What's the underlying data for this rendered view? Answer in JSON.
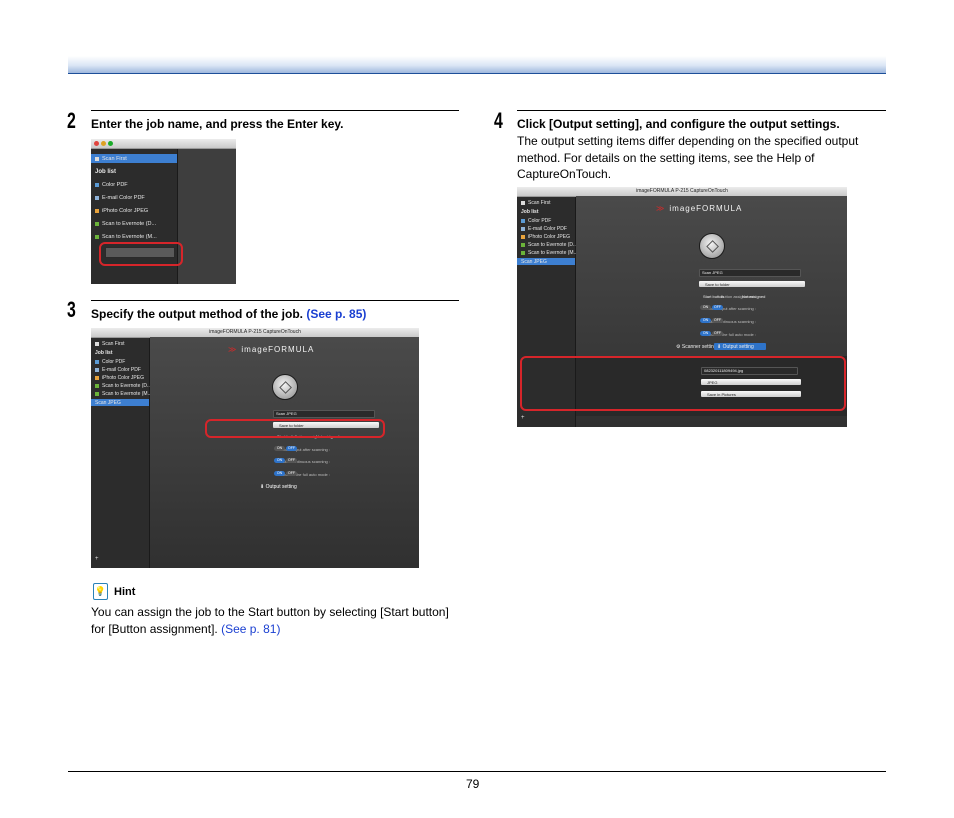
{
  "page": {
    "number": "79"
  },
  "step2": {
    "num": "2",
    "title": "Enter the job name, and press the Enter key.",
    "screenshot": {
      "sidebar": {
        "selected": "Scan First",
        "header": "Job list",
        "items": [
          "Color PDF",
          "E-mail Color PDF",
          "iPhoto Color JPEG",
          "Scan to Evernote (D...",
          "Scan to Evernote (M..."
        ]
      }
    }
  },
  "step3": {
    "num": "3",
    "title": "Specify the output method of the job.",
    "link": "(See p. 85)",
    "screenshot": {
      "window_title": "imageFORMULA P-215 CaptureOnTouch",
      "sidebar": {
        "selected": "Scan First",
        "header": "Job list",
        "items": [
          "Color PDF",
          "E-mail Color PDF",
          "iPhoto Color JPEG",
          "Scan to Evernote (D...",
          "Scan to Evernote (M..."
        ],
        "new_item": "Scan JPEG"
      },
      "logo": "imageFORMULA",
      "fields": {
        "job_title_label": "Job title :",
        "job_title_value": "Scan JPEG",
        "output_method_label": "Output method selection :",
        "output_method_value": "Save to folder",
        "button_assignment_label": "Button assignment :",
        "start_button": "Start button",
        "not_assigned": "Not assigned",
        "check_output_label": "Check output after scanning :",
        "continuous_label": "Enable continuous scanning :",
        "full_auto_label": "Scan in the full auto mode :",
        "on": "ON",
        "off": "OFF"
      },
      "output_setting": "Output setting"
    }
  },
  "hint": {
    "title": "Hint",
    "text": "You can assign the job to the Start button by selecting [Start button] for [Button assignment].",
    "link": "(See p. 81)"
  },
  "step4": {
    "num": "4",
    "title": "Click [Output setting], and configure the output settings.",
    "body": "The output setting items differ depending on the specified output method. For details on the setting items, see the Help of CaptureOnTouch.",
    "screenshot": {
      "window_title": "imageFORMULA P-215 CaptureOnTouch",
      "sidebar": {
        "selected": "Scan First",
        "header": "Job list",
        "items": [
          "Color PDF",
          "E-mail Color PDF",
          "iPhoto Color JPEG",
          "Scan to Evernote (D...",
          "Scan to Evernote (M..."
        ],
        "new_item": "Scan JPEG"
      },
      "logo": "imageFORMULA",
      "fields": {
        "job_title_label": "Job title :",
        "job_title_value": "Scan JPEG",
        "output_method_label": "Output method selection :",
        "output_method_value": "Save to folder",
        "button_assignment_label": "Button assignment :",
        "start_button": "Start button",
        "not_assigned": "Not assigned",
        "check_output_label": "Check output after scanning :",
        "continuous_label": "Enable continuous scanning :",
        "full_auto_label": "Scan in the full auto mode :",
        "on": "ON",
        "off": "OFF"
      },
      "scanner_setting": "Scanner setting",
      "output_setting": "Output setting",
      "output_fields": {
        "file_name_label": "File name :",
        "file_name_value": "082320111809494.jpg",
        "file_type_label": "File type :",
        "file_type_value": "JPEG",
        "save_to_label": "Save to folder :",
        "save_to_value": "Save in Pictures"
      }
    }
  }
}
